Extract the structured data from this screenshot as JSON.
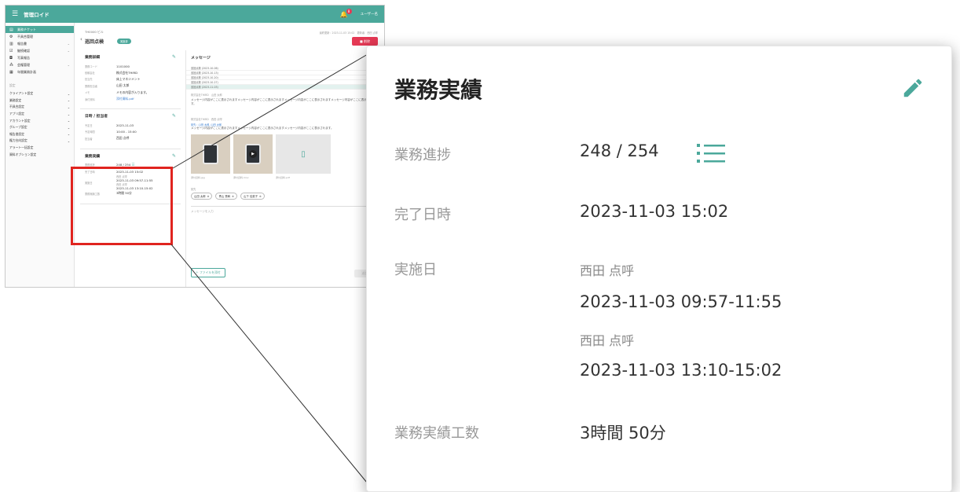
{
  "app": {
    "title": "管理ロイド",
    "notification_count": "8",
    "user": "ユーザー名"
  },
  "sidebar": {
    "items": [
      {
        "label": "業務チケット",
        "icon": "ticket-icon"
      },
      {
        "label": "不具合管理",
        "icon": "gear-icon"
      },
      {
        "label": "報告書",
        "icon": "document-icon"
      },
      {
        "label": "継続確認",
        "icon": "checklist-icon"
      },
      {
        "label": "写真報告",
        "icon": "camera-icon"
      },
      {
        "label": "会権管理",
        "icon": "org-icon"
      },
      {
        "label": "年間業務計画",
        "icon": "calendar-icon"
      }
    ],
    "settings_header": "設定",
    "settings": [
      "クライアント設定",
      "業務設定",
      "不具合設定",
      "アプリ設定",
      "アカウント設定",
      "グループ設定",
      "報告書設定",
      "権力台向設定",
      "アラート一括設定",
      "資料オプション設定"
    ]
  },
  "page": {
    "breadcrumb": "TH0000 ビル",
    "title": "巡回点検",
    "badge": "実施済",
    "meta": "最終更新：2023-11-03 15:02　更新者：西田 点呼",
    "delete_label": "削除"
  },
  "details": {
    "title": "業務詳細",
    "rows": [
      {
        "k": "業務コード",
        "v": "1101000"
      },
      {
        "k": "依頼会社",
        "v": "株式会社THIRD"
      },
      {
        "k": "担当先",
        "v": "床上マネジメント"
      },
      {
        "k": "業務担当者",
        "v": "山田 太郎"
      },
      {
        "k": "メモ",
        "v": "メモの内容が入ります。"
      },
      {
        "k": "添付資料",
        "v": "添付資料.pdf"
      }
    ]
  },
  "schedule": {
    "title": "日時 / 担当者",
    "rows": [
      {
        "k": "予定日",
        "v": "2023-11-03"
      },
      {
        "k": "予定時間",
        "v": "10:00 - 15:00"
      },
      {
        "k": "担当者",
        "v": "西田 点呼"
      }
    ]
  },
  "result": {
    "title": "業務実績",
    "progress_label": "業務進捗",
    "progress": "248 / 254",
    "completed_label": "完了日時",
    "completed": "2023-11-03  15:02",
    "date_label": "実施日",
    "sessions": [
      {
        "person": "西田 点呼",
        "time": "2023-11-03  09:57-11:55"
      },
      {
        "person": "西田 点呼",
        "time": "2023-11-03  13:10-15:02"
      }
    ],
    "effort_label": "業務実績工数",
    "effort": "3時間 50分"
  },
  "messages": {
    "title": "メッセージ",
    "history": [
      "巡回点検 (2023-10-06)",
      "巡回点検 (2023-10-13)",
      "巡回点検 (2023-10-20)",
      "巡回点検 (2023-10-27)",
      "巡回点検 (2023-11-03)"
    ],
    "msg1_meta": "株式会社THIRD　山田 太郎",
    "msg1_body": "メッセージ内容がここに表示されますメッセージ内容がここに表示されますメッセージ内容がここに表示されますメッセージ内容がここに表示されます。",
    "msg2_meta": "株式会社THIRD　西田 点呼",
    "msg2_link": "宛先：山田 太郎, 山田 太郎",
    "msg2_body": "メッセージ内容がここに表示されますメッセージ内容がここに表示されますメッセージ内容がここに表示されます。",
    "attachments": [
      "添付資料.jpg",
      "添付資料.mov",
      "添付資料.pdf"
    ],
    "to_label": "宛先",
    "recipients": [
      "山田 太郎",
      "青山 秀幹",
      "山下 佳菜子"
    ],
    "input_placeholder": "メッセージを入力",
    "attach_label": "ファイルを添付",
    "send_label": "送信"
  },
  "colors": {
    "accent": "#4ba89b",
    "danger": "#e53955",
    "highlight": "#e0241f"
  }
}
